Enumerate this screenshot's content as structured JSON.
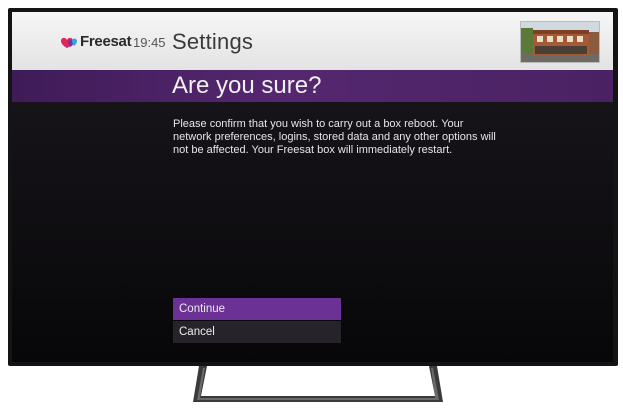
{
  "header": {
    "brand": "Freesat",
    "time": "19:45",
    "page_title": "Settings"
  },
  "dialog": {
    "title": "Are you sure?",
    "message": "Please confirm that you wish to carry out a box reboot. Your network preferences, logins, stored data and any other options will not be affected. Your Freesat box will immediately restart.",
    "options": [
      {
        "label": "Continue",
        "selected": true
      },
      {
        "label": "Cancel",
        "selected": false
      }
    ]
  },
  "colors": {
    "accent_purple": "#6b3195",
    "subtitle_bar": "#4a2263"
  },
  "icons": {
    "logo": "freesat-heart-logo-icon",
    "preview": "live-tv-preview-thumbnail"
  }
}
